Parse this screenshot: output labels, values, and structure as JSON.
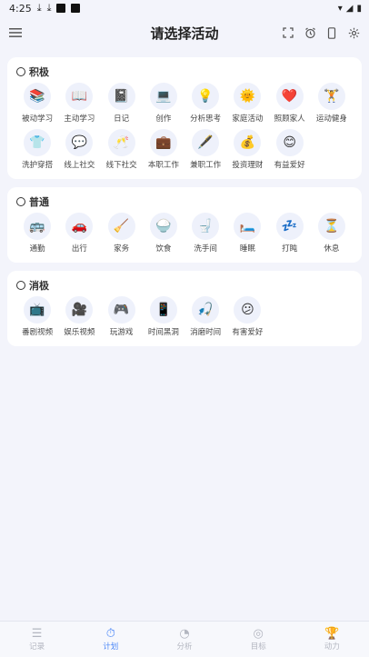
{
  "status": {
    "time": "4:25"
  },
  "header": {
    "title": "请选择活动"
  },
  "sections": [
    {
      "title": "积极",
      "items": [
        {
          "label": "被动学习",
          "icon": "📚"
        },
        {
          "label": "主动学习",
          "icon": "📖"
        },
        {
          "label": "日记",
          "icon": "📓"
        },
        {
          "label": "创作",
          "icon": "💻"
        },
        {
          "label": "分析思考",
          "icon": "💡"
        },
        {
          "label": "家庭活动",
          "icon": "🌞"
        },
        {
          "label": "照顾家人",
          "icon": "❤️"
        },
        {
          "label": "运动健身",
          "icon": "🏋️"
        },
        {
          "label": "洗护穿搭",
          "icon": "👕"
        },
        {
          "label": "线上社交",
          "icon": "💬"
        },
        {
          "label": "线下社交",
          "icon": "🥂"
        },
        {
          "label": "本职工作",
          "icon": "💼"
        },
        {
          "label": "兼职工作",
          "icon": "🖋️"
        },
        {
          "label": "投资理财",
          "icon": "💰"
        },
        {
          "label": "有益爱好",
          "icon": "😊"
        }
      ]
    },
    {
      "title": "普通",
      "items": [
        {
          "label": "通勤",
          "icon": "🚌"
        },
        {
          "label": "出行",
          "icon": "🚗"
        },
        {
          "label": "家务",
          "icon": "🧹"
        },
        {
          "label": "饮食",
          "icon": "🍚"
        },
        {
          "label": "洗手间",
          "icon": "🚽"
        },
        {
          "label": "睡眠",
          "icon": "🛏️"
        },
        {
          "label": "打盹",
          "icon": "💤"
        },
        {
          "label": "休息",
          "icon": "⏳"
        }
      ]
    },
    {
      "title": "消极",
      "items": [
        {
          "label": "番剧视频",
          "icon": "📺"
        },
        {
          "label": "娱乐视频",
          "icon": "🎥"
        },
        {
          "label": "玩游戏",
          "icon": "🎮"
        },
        {
          "label": "时间黑洞",
          "icon": "📱"
        },
        {
          "label": "消磨时间",
          "icon": "🎣"
        },
        {
          "label": "有害爱好",
          "icon": "😕"
        }
      ]
    }
  ],
  "tabs": [
    {
      "label": "记录",
      "icon": "☰",
      "active": false
    },
    {
      "label": "计划",
      "icon": "⏱",
      "active": true
    },
    {
      "label": "分析",
      "icon": "◔",
      "active": false
    },
    {
      "label": "目标",
      "icon": "◎",
      "active": false
    },
    {
      "label": "动力",
      "icon": "🏆",
      "active": false
    }
  ]
}
